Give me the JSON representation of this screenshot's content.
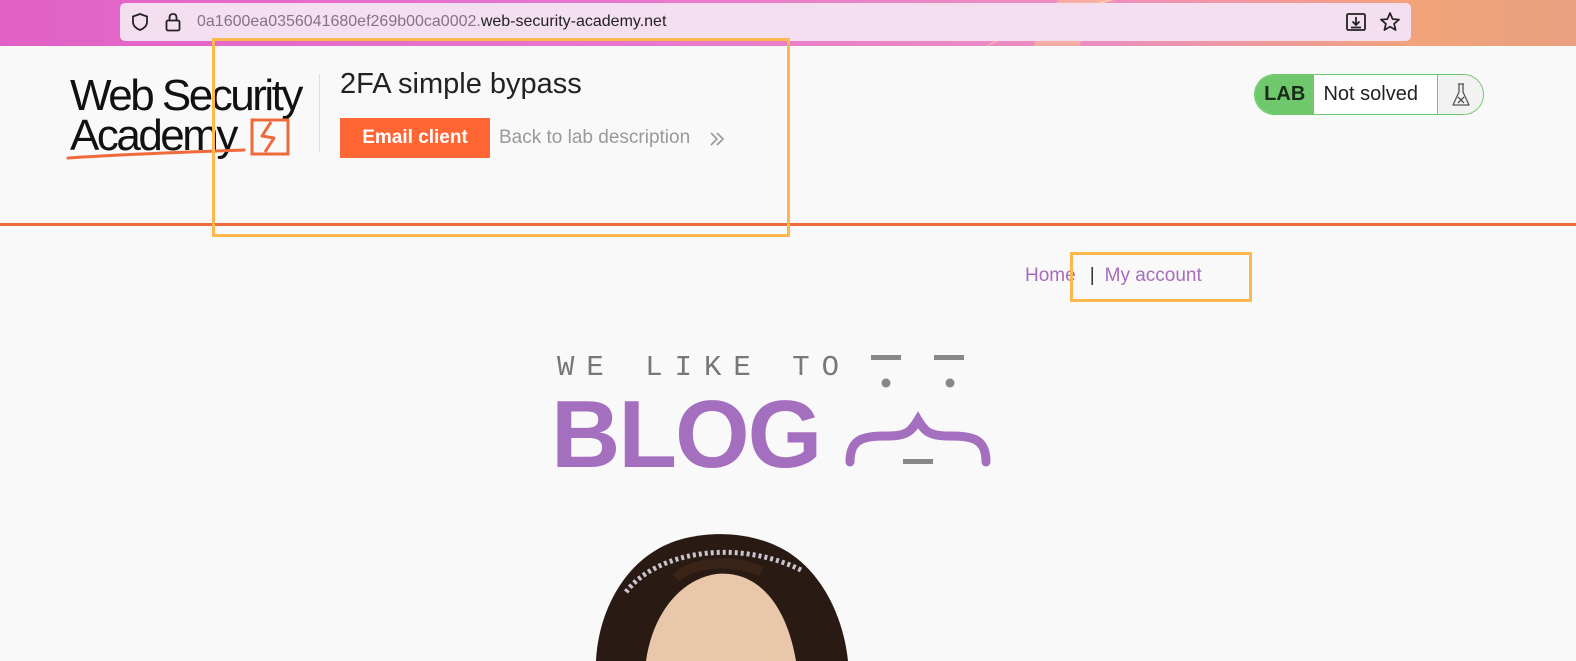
{
  "browser": {
    "url_subdomain": "0a1600ea0356041680ef269b00ca0002.",
    "url_domain": "web-security-academy.net",
    "icons": [
      "shield-icon",
      "lock-icon",
      "download-icon",
      "star-icon"
    ]
  },
  "header": {
    "logo_line1": "Web Security",
    "logo_line2": "Academy",
    "lab_title": "2FA simple bypass",
    "email_client_label": "Email client",
    "back_link_label": "Back to lab description",
    "lab_tag": "LAB",
    "lab_status": "Not solved"
  },
  "nav": {
    "home_label": "Home",
    "separator": "|",
    "account_label": "My account"
  },
  "banner": {
    "tagline": "WE LIKE TO",
    "blog_word": "BLOG"
  },
  "colors": {
    "accent_orange": "#ff6633",
    "lab_green": "#6fc86b",
    "link_purple": "#a86cbe",
    "blog_purple": "#a56fbf",
    "highlight_yellow": "#ffb84d"
  }
}
